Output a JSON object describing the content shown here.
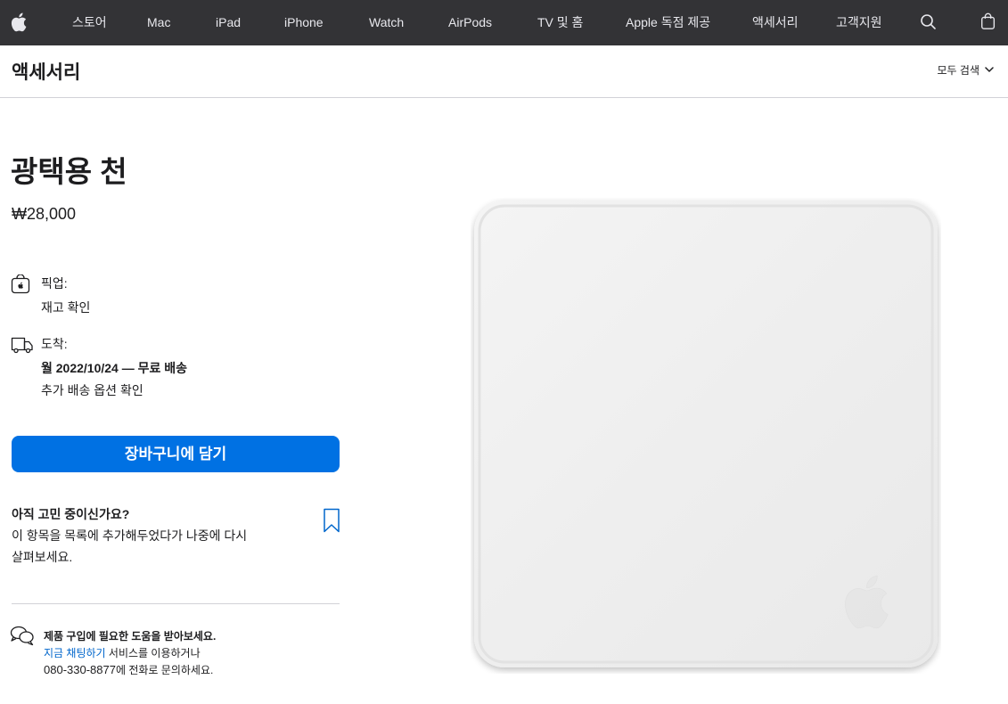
{
  "nav": {
    "items": [
      {
        "label": "스토어",
        "name": "nav-store"
      },
      {
        "label": "Mac",
        "name": "nav-mac"
      },
      {
        "label": "iPad",
        "name": "nav-ipad"
      },
      {
        "label": "iPhone",
        "name": "nav-iphone"
      },
      {
        "label": "Watch",
        "name": "nav-watch"
      },
      {
        "label": "AirPods",
        "name": "nav-airpods"
      },
      {
        "label": "TV 및 홈",
        "name": "nav-tv-home"
      },
      {
        "label": "Apple 독점 제공",
        "name": "nav-only-at-apple"
      },
      {
        "label": "액세서리",
        "name": "nav-accessories"
      },
      {
        "label": "고객지원",
        "name": "nav-support"
      }
    ],
    "icons": [
      "apple-logo-icon",
      "search-icon",
      "bag-icon"
    ]
  },
  "localnav": {
    "title": "액세서리",
    "menu_label": "모두 검색"
  },
  "product": {
    "title": "광택용 천",
    "price": "₩28,000"
  },
  "pickup": {
    "label": "픽업:",
    "link": "재고 확인"
  },
  "delivery": {
    "label": "도착:",
    "date": "월 2022/10/24 — 무료 배송",
    "link": "추가 배송 옵션 확인"
  },
  "cart": {
    "button_label": "장바구니에 담기"
  },
  "save": {
    "title": "아직 고민 중이신가요?",
    "text": "이 항목을 목록에 추가해두었다가 나중에 다시 살펴보세요."
  },
  "help": {
    "title": "제품 구입에 필요한 도움을 받아보세요.",
    "chat_link": "지금 채팅하기",
    "chat_suffix": " 서비스를 이용하거나",
    "phone": "080-330-8877",
    "phone_suffix": "에 전화로 문의하세요."
  },
  "colors": {
    "nav_bg": "#333336",
    "link": "#0066cc",
    "button": "#0071e3"
  }
}
